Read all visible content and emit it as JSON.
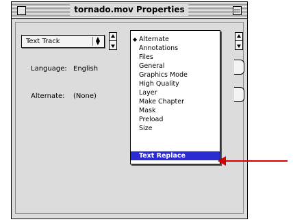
{
  "window": {
    "title": "tornado.mov Properties"
  },
  "track_popup": {
    "selected": "Text Track"
  },
  "fields": {
    "language_label": "Language:",
    "language_value": "English",
    "alternate_label": "Alternate:",
    "alternate_value": "(None)"
  },
  "menu": {
    "checkmark": "◆",
    "items": [
      "Alternate",
      "Annotations",
      "Files",
      "General",
      "Graphics Mode",
      "High Quality",
      "Layer",
      "Make Chapter",
      "Mask",
      "Preload",
      "Size",
      "Text Replace"
    ],
    "checked_index": 0,
    "highlighted_index": 11
  },
  "colors": {
    "highlight": "#2b2bd2",
    "annotation_arrow": "#d40000"
  }
}
